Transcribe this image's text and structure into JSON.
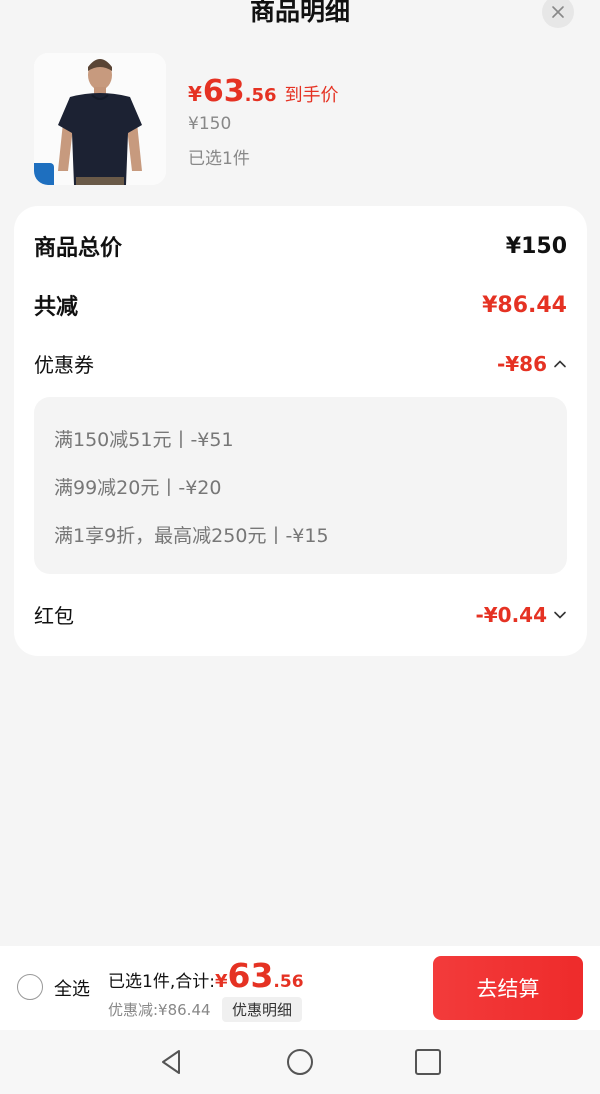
{
  "header": {
    "title": "商品明细"
  },
  "product": {
    "price_currency": "¥",
    "price_int": "63",
    "price_dec": ".56",
    "price_tag": "到手价",
    "original_price": "¥150",
    "selected_count": "已选1件"
  },
  "summary": {
    "total_label": "商品总价",
    "total_value": "¥150",
    "reduce_label": "共减",
    "reduce_value": "¥86.44",
    "coupon_label": "优惠券",
    "coupon_value": "-¥86",
    "coupons": [
      "满150减51元丨-¥51",
      "满99减20元丨-¥20",
      "满1享9折，最高减250元丨-¥15"
    ],
    "redpacket_label": "红包",
    "redpacket_value": "-¥0.44"
  },
  "bottom_bar": {
    "select_all": "全选",
    "total_prefix": "已选1件,合计:",
    "total_currency": "¥",
    "total_int": "63",
    "total_dec": ".56",
    "discount": "优惠减:¥86.44",
    "detail_button": "优惠明细",
    "checkout_button": "去结算"
  },
  "colors": {
    "accent": "#e53223",
    "checkout": "#f03333"
  }
}
